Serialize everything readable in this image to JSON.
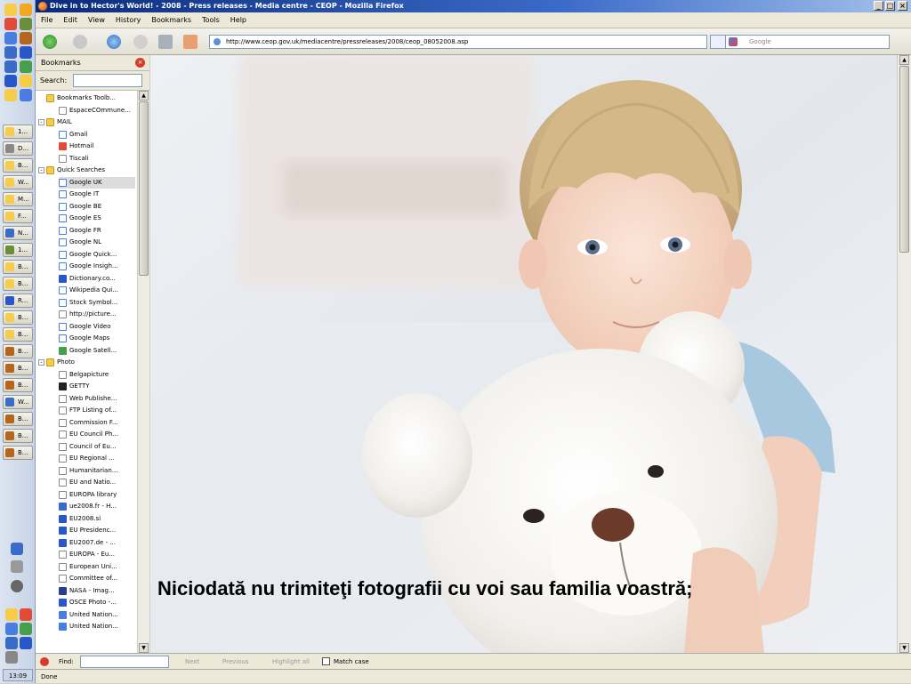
{
  "window": {
    "title": "Dive in to Hector's World! - 2008 - Press releases - Media centre - CEOP - Mozilla Firefox",
    "min_label": "_",
    "max_label": "□",
    "close_label": "×"
  },
  "menu": [
    "File",
    "Edit",
    "View",
    "History",
    "Bookmarks",
    "Tools",
    "Help"
  ],
  "navigation": {
    "url": "http://www.ceop.gov.uk/mediacentre/pressreleases/2008/ceop_08052008.asp",
    "search_placeholder": "Google"
  },
  "sidebar": {
    "title": "Bookmarks",
    "search_label": "Search:",
    "items": [
      {
        "label": "Bookmarks Toolb...",
        "type": "folder",
        "indent": 1
      },
      {
        "label": "EspaceCOmmune...",
        "type": "page",
        "indent": 2
      },
      {
        "label": "MAIL",
        "type": "folder",
        "indent": 1,
        "expander": "-"
      },
      {
        "label": "Gmail",
        "type": "google",
        "indent": 2
      },
      {
        "label": "Hotmail",
        "type": "mail",
        "indent": 2
      },
      {
        "label": "Tiscali",
        "type": "page",
        "indent": 2
      },
      {
        "label": "Quick Searches",
        "type": "folder",
        "indent": 1,
        "expander": "-"
      },
      {
        "label": "Google UK",
        "type": "google",
        "indent": 2,
        "selected": true
      },
      {
        "label": "Google IT",
        "type": "google",
        "indent": 2
      },
      {
        "label": "Google BE",
        "type": "google",
        "indent": 2
      },
      {
        "label": "Google ES",
        "type": "google",
        "indent": 2
      },
      {
        "label": "Google FR",
        "type": "google",
        "indent": 2
      },
      {
        "label": "Google NL",
        "type": "google",
        "indent": 2
      },
      {
        "label": "Google Quick...",
        "type": "google",
        "indent": 2
      },
      {
        "label": "Google Insigh...",
        "type": "google",
        "indent": 2
      },
      {
        "label": "Dictionary.co...",
        "type": "dict",
        "indent": 2
      },
      {
        "label": "Wikipedia Qui...",
        "type": "google",
        "indent": 2
      },
      {
        "label": "Stock Symbol...",
        "type": "google",
        "indent": 2
      },
      {
        "label": "http://picture...",
        "type": "page",
        "indent": 2
      },
      {
        "label": "Google Video",
        "type": "google",
        "indent": 2
      },
      {
        "label": "Google Maps",
        "type": "google",
        "indent": 2
      },
      {
        "label": "Google Satell...",
        "type": "map",
        "indent": 2
      },
      {
        "label": "Photo",
        "type": "folder",
        "indent": 1,
        "expander": "-"
      },
      {
        "label": "Belgapicture",
        "type": "page",
        "indent": 2
      },
      {
        "label": "GETTY",
        "type": "getty",
        "indent": 2
      },
      {
        "label": "Web Publishe...",
        "type": "page",
        "indent": 2
      },
      {
        "label": "FTP Listing of...",
        "type": "page",
        "indent": 2
      },
      {
        "label": "Commission F...",
        "type": "page",
        "indent": 2
      },
      {
        "label": "EU Council Ph...",
        "type": "page",
        "indent": 2
      },
      {
        "label": "Council of Eu...",
        "type": "page",
        "indent": 2
      },
      {
        "label": "EU Regional ...",
        "type": "page",
        "indent": 2
      },
      {
        "label": "Humanitarian...",
        "type": "page",
        "indent": 2
      },
      {
        "label": "EU and Natio...",
        "type": "page",
        "indent": 2
      },
      {
        "label": "EUROPA library",
        "type": "page",
        "indent": 2
      },
      {
        "label": "ue2008.fr - H...",
        "type": "flag",
        "indent": 2
      },
      {
        "label": "EU2008.si",
        "type": "dot",
        "indent": 2
      },
      {
        "label": "EU Presidenc...",
        "type": "dot",
        "indent": 2
      },
      {
        "label": "EU2007.de - ...",
        "type": "eu",
        "indent": 2
      },
      {
        "label": "EUROPA - Eu...",
        "type": "page",
        "indent": 2
      },
      {
        "label": "European Uni...",
        "type": "page",
        "indent": 2
      },
      {
        "label": "Committee of...",
        "type": "page",
        "indent": 2
      },
      {
        "label": "NASA - Imag...",
        "type": "nasa",
        "indent": 2
      },
      {
        "label": "OSCE Photo -...",
        "type": "dict",
        "indent": 2
      },
      {
        "label": "United Nation...",
        "type": "un",
        "indent": 2
      },
      {
        "label": "United Nation...",
        "type": "un",
        "indent": 2
      }
    ]
  },
  "content": {
    "caption": "Niciodată nu trimiteţi fotografii cu voi sau familia voastră;"
  },
  "findbar": {
    "label": "Find:",
    "next_label": "Next",
    "previous_label": "Previous",
    "highlight_label": "Highlight all",
    "match_case_label": "Match case"
  },
  "status": {
    "text": "Done"
  },
  "taskbar": {
    "clock": "13:09",
    "buttons": [
      "1...",
      "D...",
      "B...",
      "W...",
      "M...",
      "F...",
      "N...",
      "1...",
      "B...",
      "B...",
      "R...",
      "B...",
      "B...",
      "B...",
      "B...",
      "B...",
      "W...",
      "B...",
      "B...",
      "B..."
    ]
  },
  "colors": {
    "titlebar": "#0a2a7a",
    "chrome": "#ece9d8",
    "sidebar_bg": "#ffffff"
  }
}
